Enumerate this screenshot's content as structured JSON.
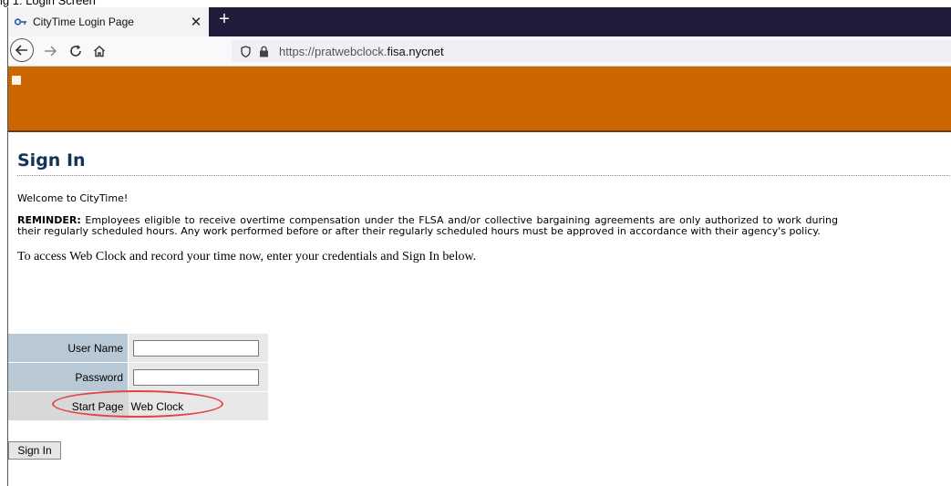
{
  "caption": "ig 1: Login Screen",
  "browser": {
    "tab_title": "CityTime Login Page",
    "tab_close": "✕",
    "new_tab": "+",
    "url_prefix": "https://pratwebclock.",
    "url_domain": "fisa.nycnet"
  },
  "page": {
    "heading": "Sign In",
    "welcome": "Welcome to CityTime!",
    "reminder_label": "REMINDER:",
    "reminder_text": " Employees eligible to receive overtime compensation under the FLSA and/or collective bargaining agreements are only authorized to work during their regularly scheduled hours. Any work performed before or after their regularly scheduled hours must be approved in accordance with their agency's policy.",
    "access_text": "To access Web Clock and record your time now, enter your credentials and Sign In below."
  },
  "form": {
    "username_label": "User Name",
    "username_value": "",
    "password_label": "Password",
    "password_value": "",
    "start_page_label": "Start Page",
    "start_page_value": "Web Clock",
    "signin_label": "Sign In"
  },
  "colors": {
    "header_orange": "#cc6600",
    "heading_blue": "#113355",
    "label_bg": "#b8c8d4",
    "highlight_red": "#e04545"
  }
}
